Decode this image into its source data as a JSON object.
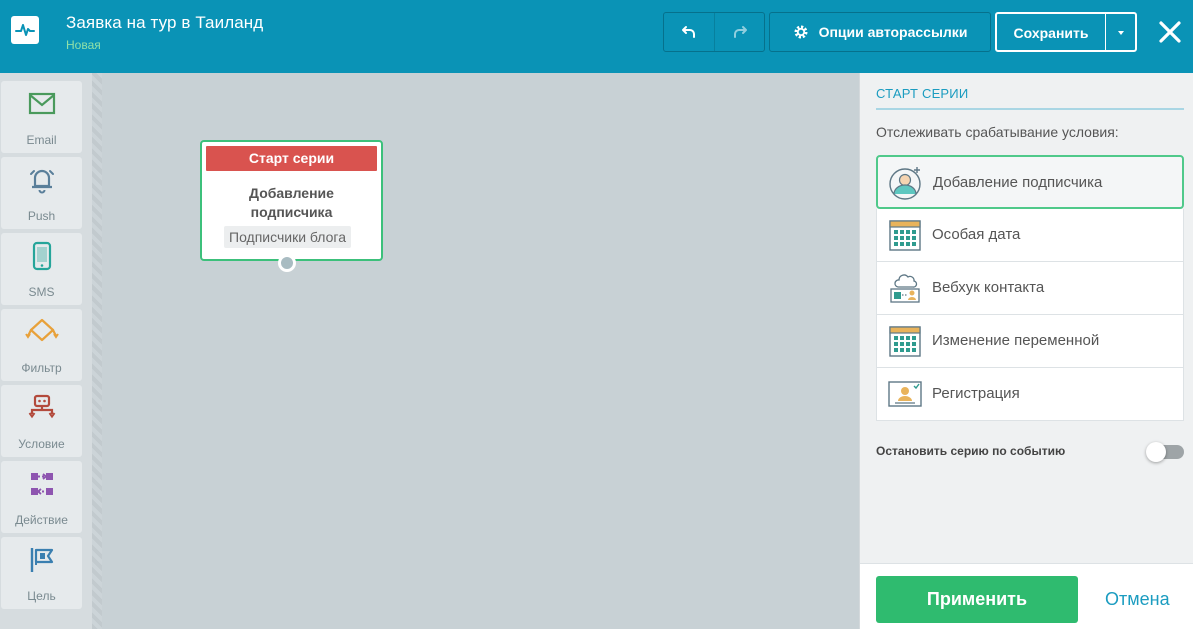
{
  "header": {
    "title": "Заявка на тур в Таиланд",
    "status": "Новая",
    "undo_icon": "undo-icon",
    "redo_icon": "redo-icon",
    "options_label": "Опции авторассылки",
    "options_icon": "gear-icon",
    "save_label": "Сохранить",
    "close_icon": "close-icon",
    "accent_color": "#0a93b6"
  },
  "toolbar": {
    "items": [
      {
        "label": "Email",
        "icon": "envelope-icon",
        "color": "#4a9a5c"
      },
      {
        "label": "Push",
        "icon": "bell-icon",
        "color": "#5a7f9a"
      },
      {
        "label": "SMS",
        "icon": "phone-icon",
        "color": "#26a59a"
      },
      {
        "label": "Фильтр",
        "icon": "filter-icon",
        "color": "#e8a13a"
      },
      {
        "label": "Условие",
        "icon": "condition-icon",
        "color": "#b34a3c"
      },
      {
        "label": "Действие",
        "icon": "action-icon",
        "color": "#8e55b0"
      },
      {
        "label": "Цель",
        "icon": "goal-flag-icon",
        "color": "#3a7fb0"
      }
    ]
  },
  "canvas": {
    "node": {
      "header": "Старт серии",
      "title": "Добавление подписчика",
      "tag": "Подписчики блога",
      "header_color": "#d9534f",
      "border_color": "#3cc07b"
    }
  },
  "panel": {
    "title": "СТАРТ СЕРИИ",
    "subtitle": "Отслеживать срабатывание условия:",
    "options": [
      {
        "label": "Добавление подписчика",
        "icon": "add-subscriber-icon",
        "selected": true
      },
      {
        "label": "Особая дата",
        "icon": "calendar-icon",
        "selected": false
      },
      {
        "label": "Вебхук контакта",
        "icon": "webhook-icon",
        "selected": false
      },
      {
        "label": "Изменение переменной",
        "icon": "calendar-variable-icon",
        "selected": false
      },
      {
        "label": "Регистрация",
        "icon": "registration-icon",
        "selected": false
      }
    ],
    "stop_label": "Остановить серию по событию",
    "stop_toggle_on": false,
    "apply_label": "Применить",
    "cancel_label": "Отмена",
    "apply_color": "#2fbb6f"
  }
}
